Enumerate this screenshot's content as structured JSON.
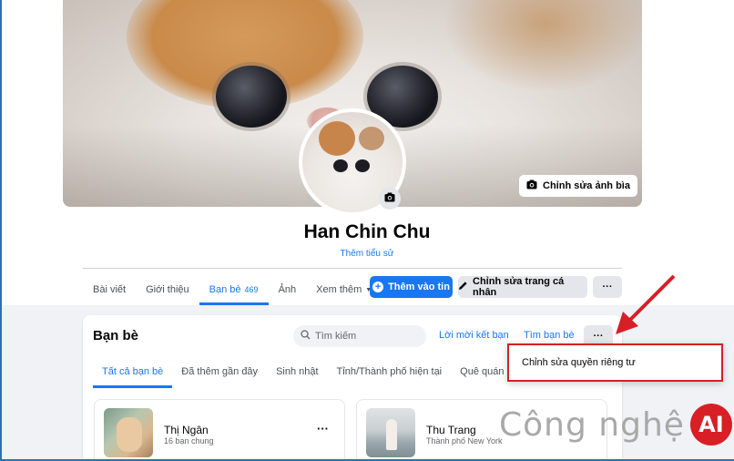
{
  "profile": {
    "name": "Han Chin Chu",
    "bio_link": "Thêm tiểu sử",
    "edit_cover_label": "Chỉnh sửa ảnh bìa"
  },
  "nav": {
    "tabs": [
      {
        "label": "Bài viết"
      },
      {
        "label": "Giới thiệu"
      },
      {
        "label": "Bạn bè",
        "count": "469"
      },
      {
        "label": "Ảnh"
      },
      {
        "label": "Xem thêm"
      }
    ],
    "add_story_label": "Thêm vào tin",
    "edit_profile_label": "Chỉnh sửa trang cá nhân",
    "more_label": "···"
  },
  "friends": {
    "title": "Bạn bè",
    "search_placeholder": "Tìm kiếm",
    "requests_link": "Lời mời kết bạn",
    "find_link": "Tìm bạn bè",
    "more_label": "···",
    "tabs": [
      "Tất cả bạn bè",
      "Đã thêm gần đây",
      "Sinh nhật",
      "Tỉnh/Thành phố hiện tại",
      "Quê quán"
    ],
    "items": [
      {
        "name": "Thị Ngân",
        "sub": "16 bạn chung",
        "more": "···"
      },
      {
        "name": "Thu Trang",
        "sub": "Thành phố New York"
      }
    ]
  },
  "menu": {
    "item": "Chỉnh sửa quyền riêng tư"
  },
  "watermark": {
    "text": "Công nghệ",
    "badge": "AI"
  },
  "colors": {
    "accent": "#1877f2",
    "highlight": "#d81f26"
  }
}
